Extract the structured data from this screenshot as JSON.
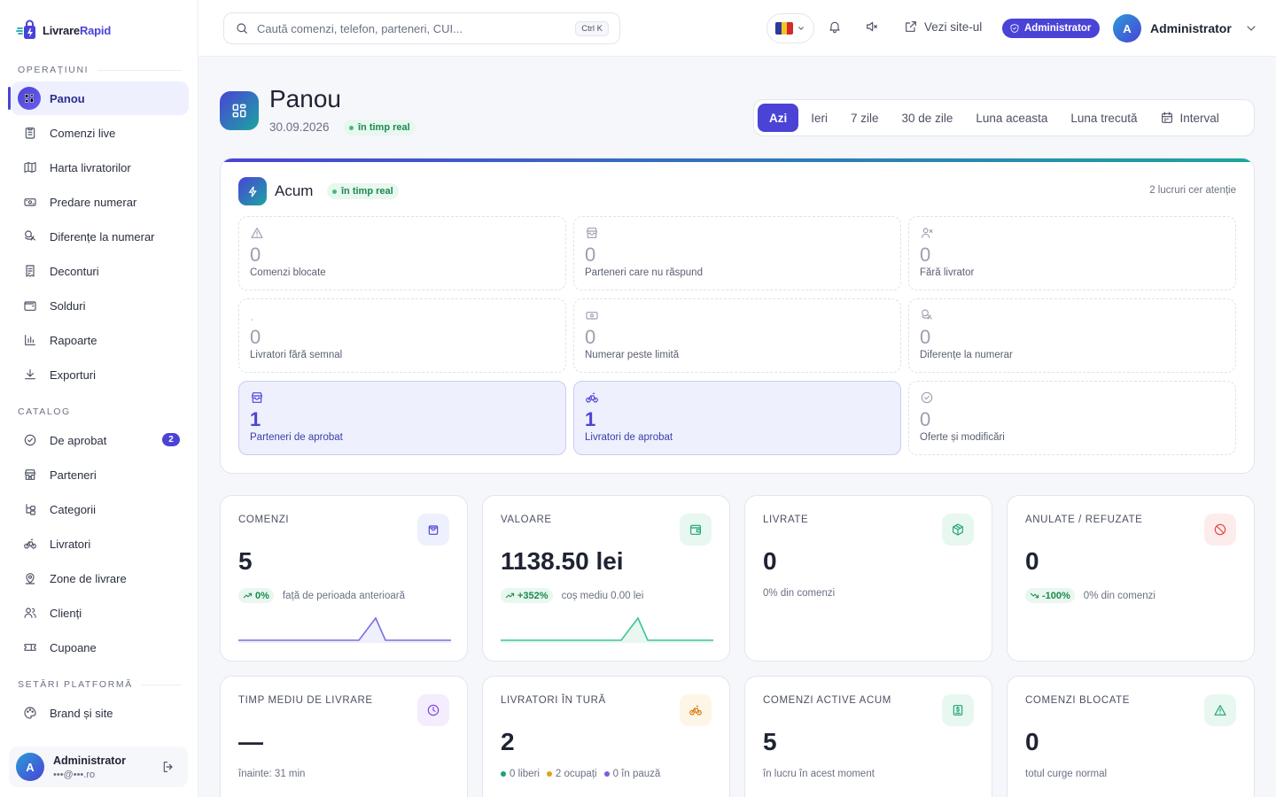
{
  "brand": {
    "name_a": "Livrare",
    "name_b": "Rapid"
  },
  "sidebar": {
    "sections": [
      {
        "title": "OPERAȚIUNI",
        "items": [
          {
            "label": "Panou",
            "icon": "dashboard-icon",
            "active": true
          },
          {
            "label": "Comenzi live",
            "icon": "clipboard-icon"
          },
          {
            "label": "Harta livratorilor",
            "icon": "map-icon"
          },
          {
            "label": "Predare numerar",
            "icon": "cash-icon"
          },
          {
            "label": "Diferențe la numerar",
            "icon": "coins-icon"
          },
          {
            "label": "Deconturi",
            "icon": "receipt-icon"
          },
          {
            "label": "Solduri",
            "icon": "wallet-icon"
          },
          {
            "label": "Rapoarte",
            "icon": "bar-chart-icon"
          },
          {
            "label": "Exporturi",
            "icon": "download-icon"
          }
        ]
      },
      {
        "title": "CATALOG",
        "items": [
          {
            "label": "De aprobat",
            "icon": "check-circle-icon",
            "badge": "2"
          },
          {
            "label": "Parteneri",
            "icon": "store-icon"
          },
          {
            "label": "Categorii",
            "icon": "tree-icon"
          },
          {
            "label": "Livratori",
            "icon": "bike-icon"
          },
          {
            "label": "Zone de livrare",
            "icon": "map-pin-icon"
          },
          {
            "label": "Clienți",
            "icon": "users-icon"
          },
          {
            "label": "Cupoane",
            "icon": "ticket-icon"
          }
        ]
      },
      {
        "title": "SETĂRI PLATFORMĂ",
        "items": [
          {
            "label": "Brand și site",
            "icon": "palette-icon"
          }
        ]
      }
    ],
    "user": {
      "initial": "A",
      "name": "Administrator",
      "email": "•••@•••.ro"
    }
  },
  "topbar": {
    "search_placeholder": "Caută comenzi, telefon, parteneri, CUI...",
    "shortcut": "Ctrl K",
    "view_site": "Vezi site-ul",
    "role_badge": "Administrator",
    "user_initial": "A",
    "user_name": "Administrator"
  },
  "page": {
    "title": "Panou",
    "date": "30.09.2026",
    "live": "în timp real",
    "tabs": [
      "Azi",
      "Ieri",
      "7 zile",
      "30 de zile",
      "Luna aceasta",
      "Luna trecută",
      "Interval"
    ],
    "active_tab": "Azi"
  },
  "now": {
    "title": "Acum",
    "live": "în timp real",
    "attention": "2 lucruri cer atenție",
    "tiles": [
      {
        "value": "0",
        "label": "Comenzi blocate",
        "icon": "warning-icon"
      },
      {
        "value": "0",
        "label": "Parteneri care nu răspund",
        "icon": "store-icon"
      },
      {
        "value": "0",
        "label": "Fără livrator",
        "icon": "user-x-icon"
      },
      {
        "value": "0",
        "label": "Livratori fără semnal",
        "icon": "signal-icon"
      },
      {
        "value": "0",
        "label": "Numerar peste limită",
        "icon": "cash-icon"
      },
      {
        "value": "0",
        "label": "Diferențe la numerar",
        "icon": "coins-icon"
      },
      {
        "value": "1",
        "label": "Parteneri de aprobat",
        "icon": "store-icon",
        "highlight": true
      },
      {
        "value": "1",
        "label": "Livratori de aprobat",
        "icon": "bike-icon",
        "highlight": true
      },
      {
        "value": "0",
        "label": "Oferte și modificări",
        "icon": "check-circle-icon"
      }
    ]
  },
  "stats": {
    "orders": {
      "title": "COMENZI",
      "value": "5",
      "change": "0%",
      "note": "față de perioada anterioară",
      "icon": "shopping-bag-icon",
      "color": "#4a43d6"
    },
    "value": {
      "title": "VALOARE",
      "value": "1138.50 lei",
      "change": "+352%",
      "note": "coș mediu 0.00 lei",
      "icon": "wallet-icon",
      "color": "#1aa37a"
    },
    "delivered": {
      "title": "LIVRATE",
      "value": "0",
      "note": "0% din comenzi",
      "icon": "package-icon",
      "color": "#1aa37a"
    },
    "cancelled": {
      "title": "ANULATE / REFUZATE",
      "value": "0",
      "change": "-100%",
      "note": "0% din comenzi",
      "icon": "ban-icon",
      "color": "#e0413f"
    },
    "avg_time": {
      "title": "TIMP MEDIU DE LIVRARE",
      "value": "—",
      "note": "înainte: 31 min",
      "icon": "clock-icon",
      "color": "#7c3aed"
    },
    "couriers": {
      "title": "LIVRATORI ÎN TURĂ",
      "value": "2",
      "free": "0 liberi",
      "busy": "2 ocupați",
      "pause": "0 în pauză",
      "icon": "bike-icon",
      "color": "#d97706"
    },
    "active": {
      "title": "COMENZI ACTIVE ACUM",
      "value": "5",
      "note": "în lucru în acest moment",
      "icon": "dollar-box-icon",
      "color": "#1aa37a"
    },
    "blocked": {
      "title": "COMENZI BLOCATE",
      "value": "0",
      "note": "totul curge normal",
      "icon": "warning-icon",
      "color": "#1aa37a"
    }
  },
  "colors": {
    "accent": "#4a43d6",
    "teal": "#1aa6a0",
    "success": "#1a8a4f",
    "danger": "#e0413f",
    "warning": "#d97706"
  }
}
